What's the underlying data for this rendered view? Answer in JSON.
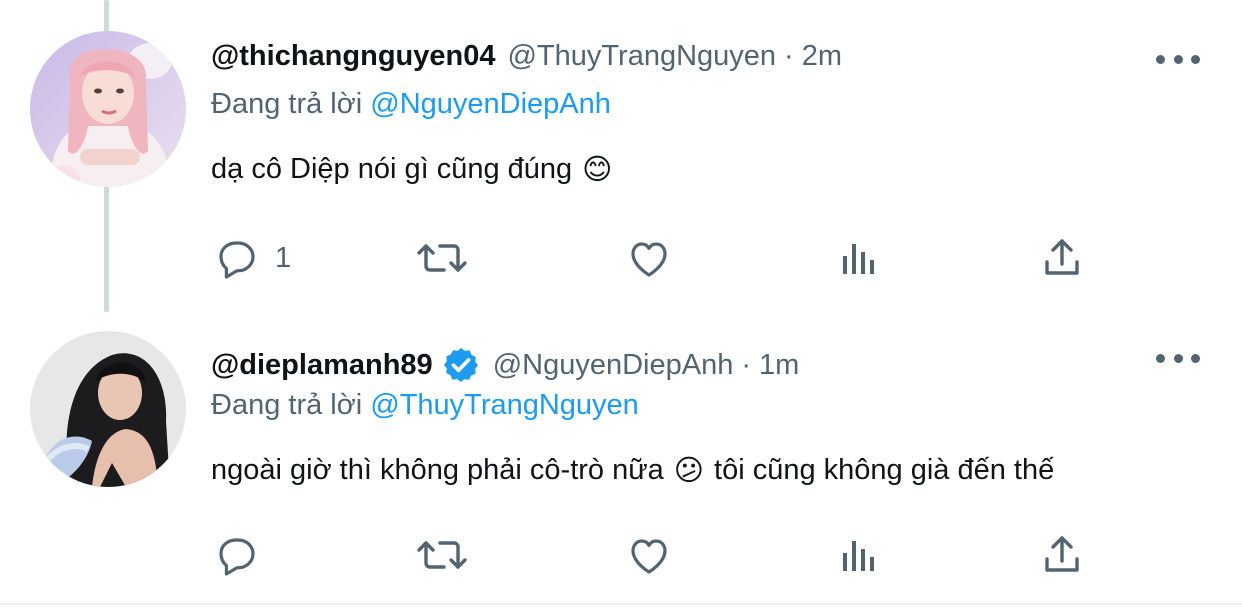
{
  "colors": {
    "accent": "#1d9bf0",
    "secondary_text": "#536471",
    "primary_text": "#0f1419"
  },
  "tweets": [
    {
      "display_name": "@thichangnguyen04",
      "handle": "@ThuyTrangNguyen",
      "separator": "·",
      "time": "2m",
      "replying_prefix": "Đang trả lời",
      "replying_to": "@NguyenDiepAnh",
      "text": "dạ cô Diệp nói gì cũng đúng",
      "emoji": "😊",
      "reply_count": "1",
      "verified": false,
      "icons": {
        "reply": "reply-icon",
        "retweet": "retweet-icon",
        "like": "like-icon",
        "views": "views-icon",
        "share": "share-icon",
        "more": "more-icon"
      }
    },
    {
      "display_name": "@dieplamanh89",
      "handle": "@NguyenDiepAnh",
      "separator": "·",
      "time": "1m",
      "replying_prefix": "Đang trả lời",
      "replying_to": "@ThuyTrangNguyen",
      "text": "ngoài giờ thì không phải cô-trò nữa",
      "emoji": "😕",
      "text_after": "tôi cũng không già đến thế",
      "reply_count": "",
      "verified": true,
      "icons": {
        "reply": "reply-icon",
        "retweet": "retweet-icon",
        "like": "like-icon",
        "views": "views-icon",
        "share": "share-icon",
        "more": "more-icon",
        "verified": "verified-badge-icon"
      }
    }
  ]
}
